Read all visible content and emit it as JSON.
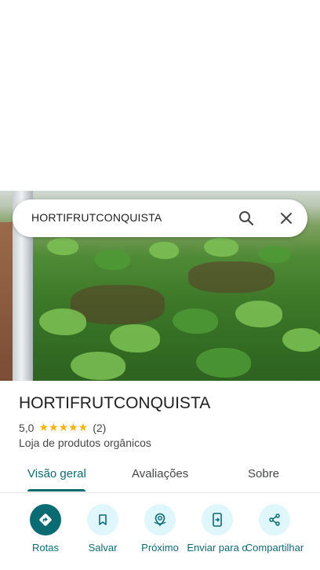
{
  "search": {
    "query": "HORTIFRUTCONQUISTA"
  },
  "place": {
    "name": "HORTIFRUTCONQUISTA",
    "rating": "5,0",
    "stars": "★★★★★",
    "review_count": "(2)",
    "category": "Loja de produtos orgânicos"
  },
  "tabs": [
    {
      "label": "Visão geral",
      "active": true
    },
    {
      "label": "Avaliações",
      "active": false
    },
    {
      "label": "Sobre",
      "active": false
    }
  ],
  "actions": [
    {
      "label": "Rotas",
      "icon": "directions-icon"
    },
    {
      "label": "Salvar",
      "icon": "bookmark-icon"
    },
    {
      "label": "Próximo",
      "icon": "nearby-icon"
    },
    {
      "label": "Enviar para o",
      "icon": "send-to-phone-icon"
    },
    {
      "label": "Compartilhar",
      "icon": "share-icon"
    }
  ],
  "colors": {
    "accent": "#0b6b73",
    "action_bg": "#dff6fb",
    "star": "#f4b400"
  }
}
